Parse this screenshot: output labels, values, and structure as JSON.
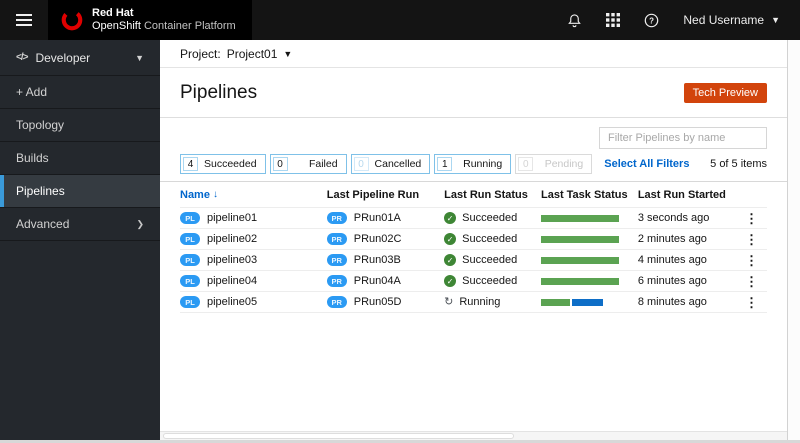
{
  "masthead": {
    "brand": {
      "line1": "Red Hat",
      "product": "OpenShift",
      "suffix": "Container Platform"
    },
    "username": "Ned Username"
  },
  "sidebar": {
    "perspective": "Developer",
    "items": [
      {
        "label": "+ Add"
      },
      {
        "label": "Topology"
      },
      {
        "label": "Builds"
      },
      {
        "label": "Pipelines"
      },
      {
        "label": "Advanced"
      }
    ]
  },
  "project_bar": {
    "label": "Project:",
    "value": "Project01"
  },
  "page": {
    "title": "Pipelines",
    "tech_preview": "Tech Preview"
  },
  "toolbar": {
    "filter_placeholder": "Filter Pipelines by name",
    "select_all": "Select All Filters",
    "items_count": "5 of 5 items",
    "chips": [
      {
        "count": "4",
        "label": "Succeeded",
        "state": "normal"
      },
      {
        "count": "0",
        "label": "Failed",
        "state": "normal"
      },
      {
        "count": "0",
        "label": "Cancelled",
        "state": "zero"
      },
      {
        "count": "1",
        "label": "Running",
        "state": "normal"
      },
      {
        "count": "0",
        "label": "Pending",
        "state": "disabled"
      }
    ]
  },
  "table": {
    "headers": [
      "Name",
      "Last Pipeline Run",
      "Last Run Status",
      "Last Task Status",
      "Last Run Started"
    ],
    "rows": [
      {
        "badge": "PL",
        "name": "pipeline01",
        "run_badge": "PR",
        "run": "PRun01A",
        "status": "Succeeded",
        "status_icon": "check",
        "task_segments": [
          {
            "color": "#5ba352",
            "width": 78
          }
        ],
        "started": "3 seconds ago"
      },
      {
        "badge": "PL",
        "name": "pipeline02",
        "run_badge": "PR",
        "run": "PRun02C",
        "status": "Succeeded",
        "status_icon": "check",
        "task_segments": [
          {
            "color": "#5ba352",
            "width": 78
          }
        ],
        "started": "2 minutes ago"
      },
      {
        "badge": "PL",
        "name": "pipeline03",
        "run_badge": "PR",
        "run": "PRun03B",
        "status": "Succeeded",
        "status_icon": "check",
        "task_segments": [
          {
            "color": "#5ba352",
            "width": 78
          }
        ],
        "started": "4 minutes ago"
      },
      {
        "badge": "PL",
        "name": "pipeline04",
        "run_badge": "PR",
        "run": "PRun04A",
        "status": "Succeeded",
        "status_icon": "check",
        "task_segments": [
          {
            "color": "#5ba352",
            "width": 78
          }
        ],
        "started": "6 minutes ago"
      },
      {
        "badge": "PL",
        "name": "pipeline05",
        "run_badge": "PR",
        "run": "PRun05D",
        "status": "Running",
        "status_icon": "sync",
        "task_segments": [
          {
            "color": "#5ba352",
            "width": 29
          },
          {
            "color": "#0e6ec7",
            "width": 31
          }
        ],
        "started": "8 minutes ago"
      }
    ]
  },
  "colors": {
    "accent_blue": "#0066cc",
    "success_green": "#3e8635",
    "bar_green": "#5ba352",
    "running_blue": "#0e6ec7",
    "tech_preview_orange": "#d2440c",
    "nav_active_border": "#3a9ad9"
  }
}
